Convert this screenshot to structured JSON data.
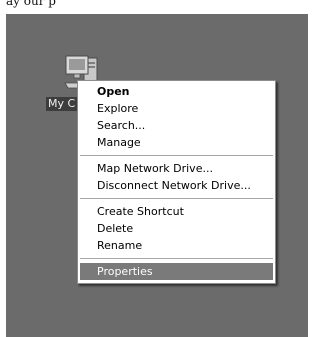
{
  "caption": "ay our p",
  "desktop": {
    "icon_label": "My C",
    "icon_name": "computer-icon"
  },
  "menu": {
    "groups": [
      [
        {
          "label": "Open",
          "bold": true
        },
        {
          "label": "Explore"
        },
        {
          "label": "Search..."
        },
        {
          "label": "Manage"
        }
      ],
      [
        {
          "label": "Map Network Drive..."
        },
        {
          "label": "Disconnect Network Drive..."
        }
      ],
      [
        {
          "label": "Create Shortcut"
        },
        {
          "label": "Delete"
        },
        {
          "label": "Rename"
        }
      ],
      [
        {
          "label": "Properties",
          "selected": true
        }
      ]
    ]
  },
  "colors": {
    "desktop": "#6b6b6b",
    "highlight": "#7a7a7a"
  }
}
